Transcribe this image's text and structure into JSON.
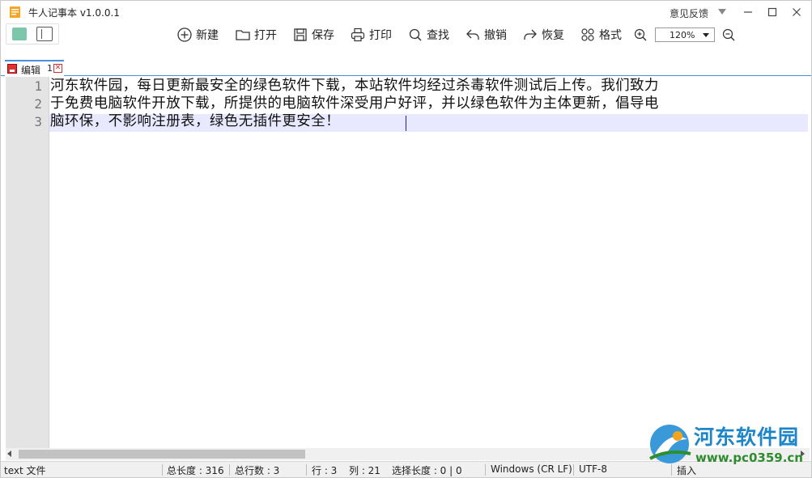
{
  "app": {
    "title": "牛人记事本 v1.0.0.1",
    "feedback_label": "意见反馈"
  },
  "toolbar": {
    "new_label": "新建",
    "open_label": "打开",
    "save_label": "保存",
    "print_label": "打印",
    "find_label": "查找",
    "undo_label": "撤销",
    "redo_label": "恢复",
    "format_label": "格式",
    "zoom_value": "120%"
  },
  "tab": {
    "label": "编辑",
    "number": "1"
  },
  "editor": {
    "line_numbers": [
      "1",
      "2",
      "3"
    ],
    "lines": [
      "河东软件园，每日更新最安全的绿色软件下载，本站软件均经过杀毒软件测试后上传。我们致力",
      "于免费电脑软件开放下载，所提供的电脑软件深受用户好评，并以绿色软件为主体更新，倡导电",
      "脑环保，不影响注册表，绿色无插件更安全！"
    ]
  },
  "statusbar": {
    "file_type": "text 文件",
    "total_length": "总长度 : 316",
    "total_lines": "总行数 : 3",
    "row": "行 : 3",
    "col": "列 : 21",
    "selection": "选择长度 : 0 | 0",
    "line_ending": "Windows (CR LF)",
    "encoding": "UTF-8",
    "mode": "插入"
  },
  "watermark": {
    "title": "河东软件园",
    "url": "www.pc0359.cn"
  },
  "colors": {
    "accent": "#4a90d9",
    "current_line": "#e8e8ff",
    "toggle_green": "#7cc6ac"
  }
}
